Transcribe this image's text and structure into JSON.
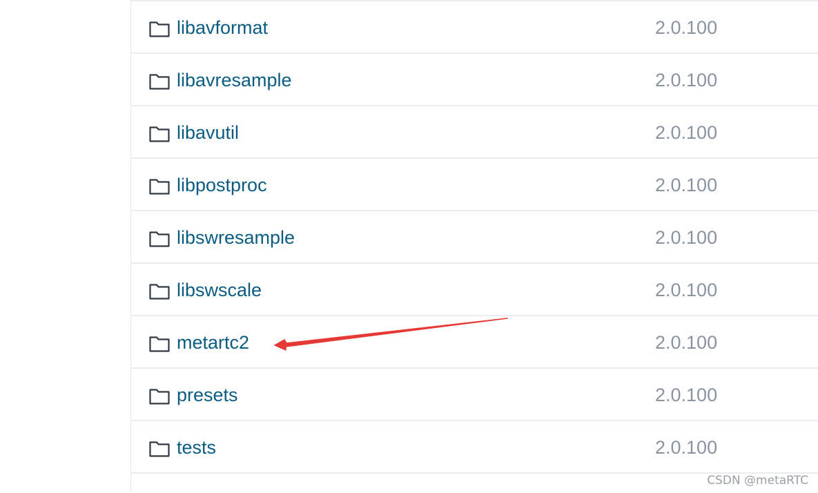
{
  "files": [
    {
      "name": "libavformat",
      "version": "2.0.100",
      "icon": "folder-icon"
    },
    {
      "name": "libavresample",
      "version": "2.0.100",
      "icon": "folder-icon"
    },
    {
      "name": "libavutil",
      "version": "2.0.100",
      "icon": "folder-icon"
    },
    {
      "name": "libpostproc",
      "version": "2.0.100",
      "icon": "folder-icon"
    },
    {
      "name": "libswresample",
      "version": "2.0.100",
      "icon": "folder-icon"
    },
    {
      "name": "libswscale",
      "version": "2.0.100",
      "icon": "folder-icon"
    },
    {
      "name": "metartc2",
      "version": "2.0.100",
      "icon": "folder-icon"
    },
    {
      "name": "presets",
      "version": "2.0.100",
      "icon": "folder-icon"
    },
    {
      "name": "tests",
      "version": "2.0.100",
      "icon": "folder-icon"
    }
  ],
  "annotation": {
    "type": "arrow",
    "color": "#e53935",
    "target": "metartc2"
  },
  "watermark": "CSDN @metaRTC",
  "colors": {
    "link": "#0b5c82",
    "version": "#8a94a0",
    "divider": "#eaecef",
    "arrow": "#e53935"
  }
}
